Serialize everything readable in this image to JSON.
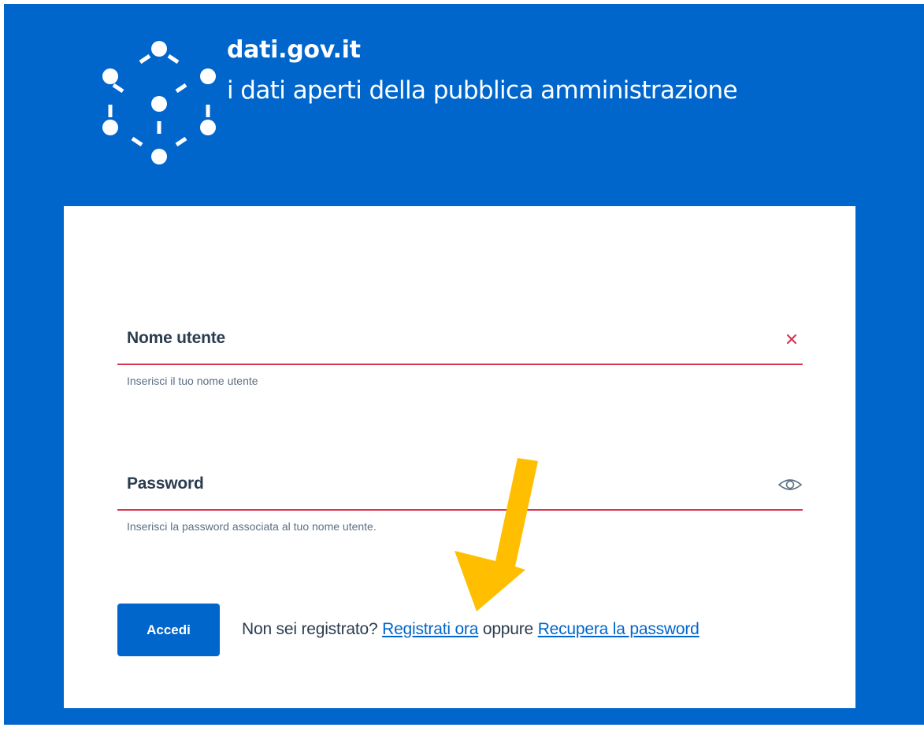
{
  "brand": {
    "name": "dati.gov.it",
    "tagline": "i dati aperti della pubblica amministrazione"
  },
  "login": {
    "username": {
      "label": "Nome utente",
      "value": "",
      "helper": "Inserisci il tuo nome utente"
    },
    "password": {
      "label": "Password",
      "value": "",
      "helper": "Inserisci la password associata al tuo nome utente."
    },
    "submit_label": "Accedi",
    "register_prompt": "Non sei registrato?",
    "register_link": "Registrati ora",
    "separator": "oppure",
    "recover_link": "Recupera la password"
  },
  "icons": {
    "logo": "dati-network-logo-icon",
    "clear": "close-icon",
    "show_password": "eye-icon",
    "annotation": "arrow-down-icon"
  },
  "colors": {
    "brand_blue": "#0066cc",
    "error_red": "#d9364f",
    "annotation_yellow": "#ffbf00",
    "label_text": "#2b3c4f",
    "helper_text": "#5c6f82"
  }
}
